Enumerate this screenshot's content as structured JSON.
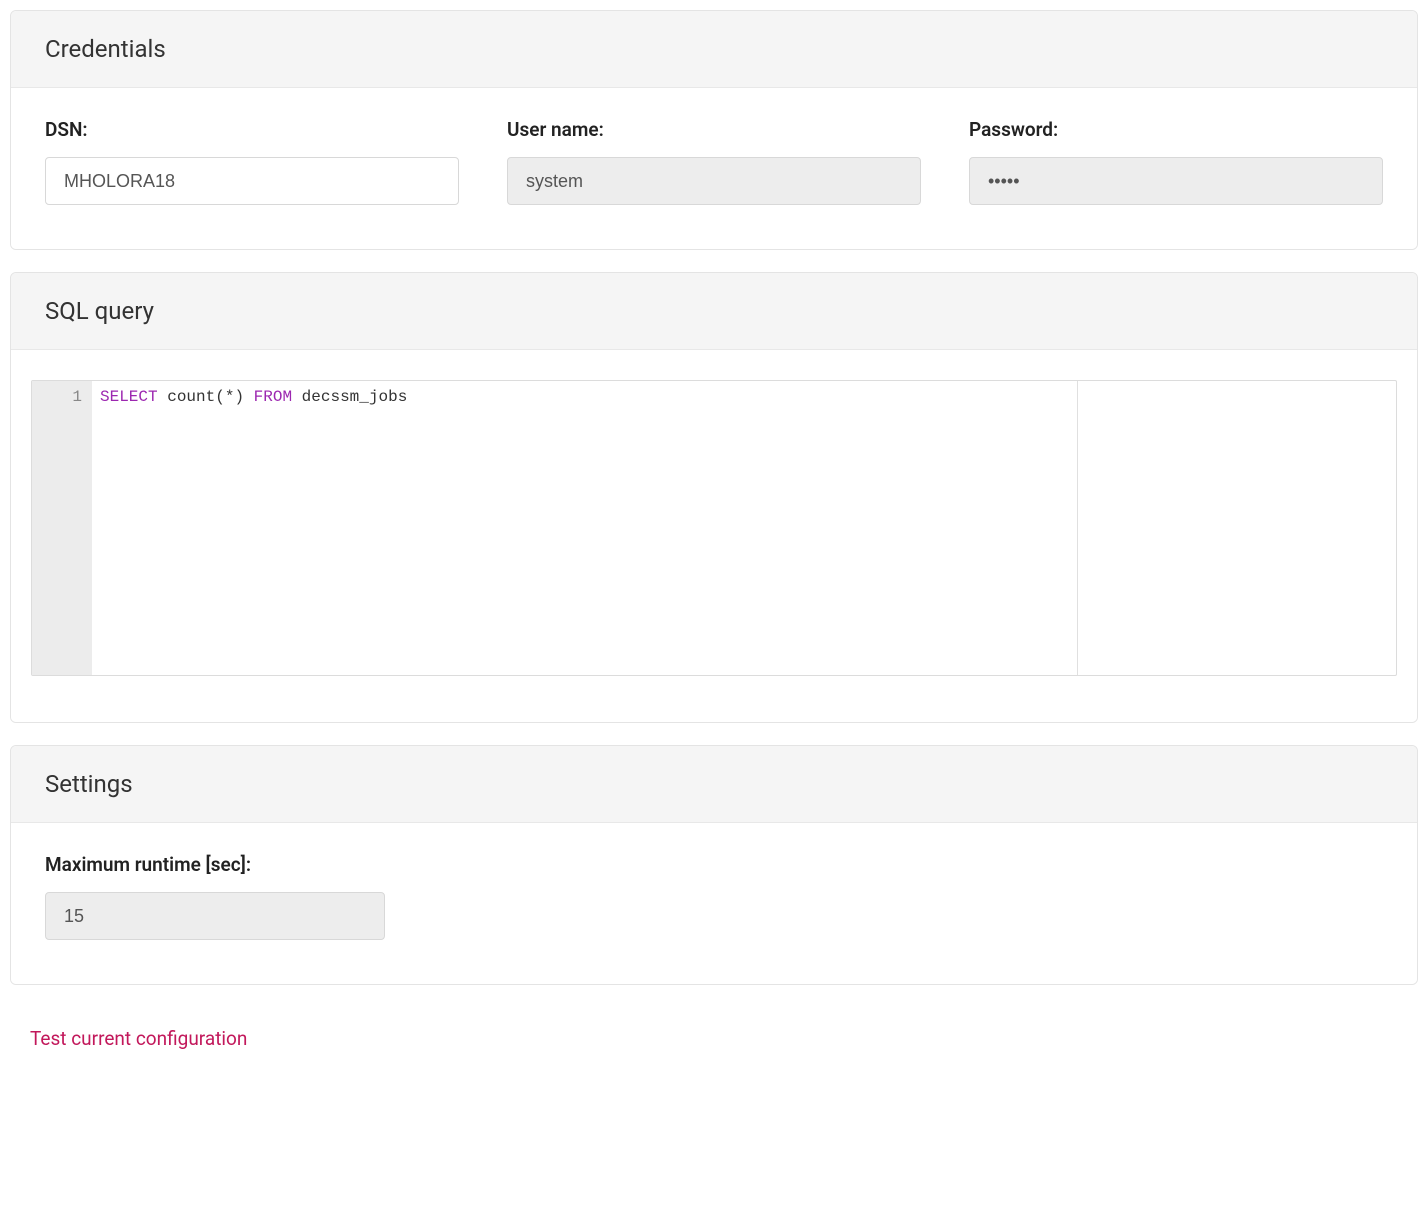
{
  "credentials": {
    "title": "Credentials",
    "dsn_label": "DSN:",
    "dsn_value": "MHOLORA18",
    "user_label": "User name:",
    "user_value": "system",
    "password_label": "Password:",
    "password_value": "•••••"
  },
  "sql": {
    "title": "SQL query",
    "line_number": "1",
    "tokens": {
      "select": "SELECT",
      "count": "count",
      "paren_star": "(*)",
      "from": "FROM",
      "table": "decssm_jobs"
    }
  },
  "settings": {
    "title": "Settings",
    "runtime_label": "Maximum runtime [sec]:",
    "runtime_value": "15"
  },
  "actions": {
    "test_link": "Test current configuration"
  }
}
